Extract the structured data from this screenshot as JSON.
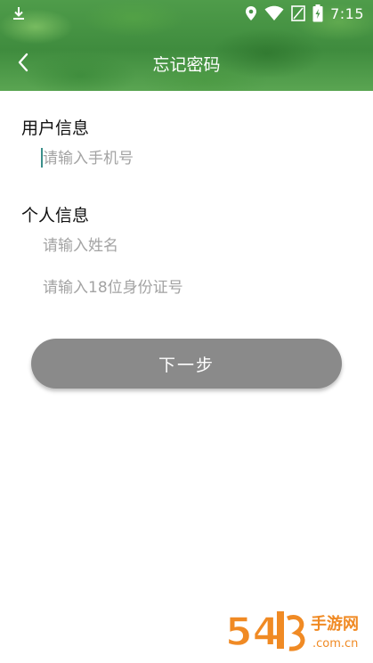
{
  "status_bar": {
    "time": "7:15",
    "icons": [
      "download-icon",
      "location-icon",
      "wifi-icon",
      "no-sim-icon",
      "battery-charging-icon"
    ]
  },
  "nav": {
    "back_icon": "chevron-left-icon",
    "title": "忘记密码"
  },
  "user_info": {
    "title": "用户信息",
    "phone_placeholder": "请输入手机号",
    "phone_value": ""
  },
  "personal_info": {
    "title": "个人信息",
    "name_placeholder": "请输入姓名",
    "name_value": "",
    "id_placeholder": "请输入18位身份证号",
    "id_value": ""
  },
  "actions": {
    "next_label": "下一步"
  },
  "watermark": {
    "text": "54 手游网 .com.cn"
  },
  "colors": {
    "header_green": "#3f8c3e",
    "button_gray": "#8a8a8a",
    "placeholder_gray": "#a3a3a3",
    "cursor_teal": "#3b8f8a",
    "watermark_orange": "#f08a24"
  }
}
